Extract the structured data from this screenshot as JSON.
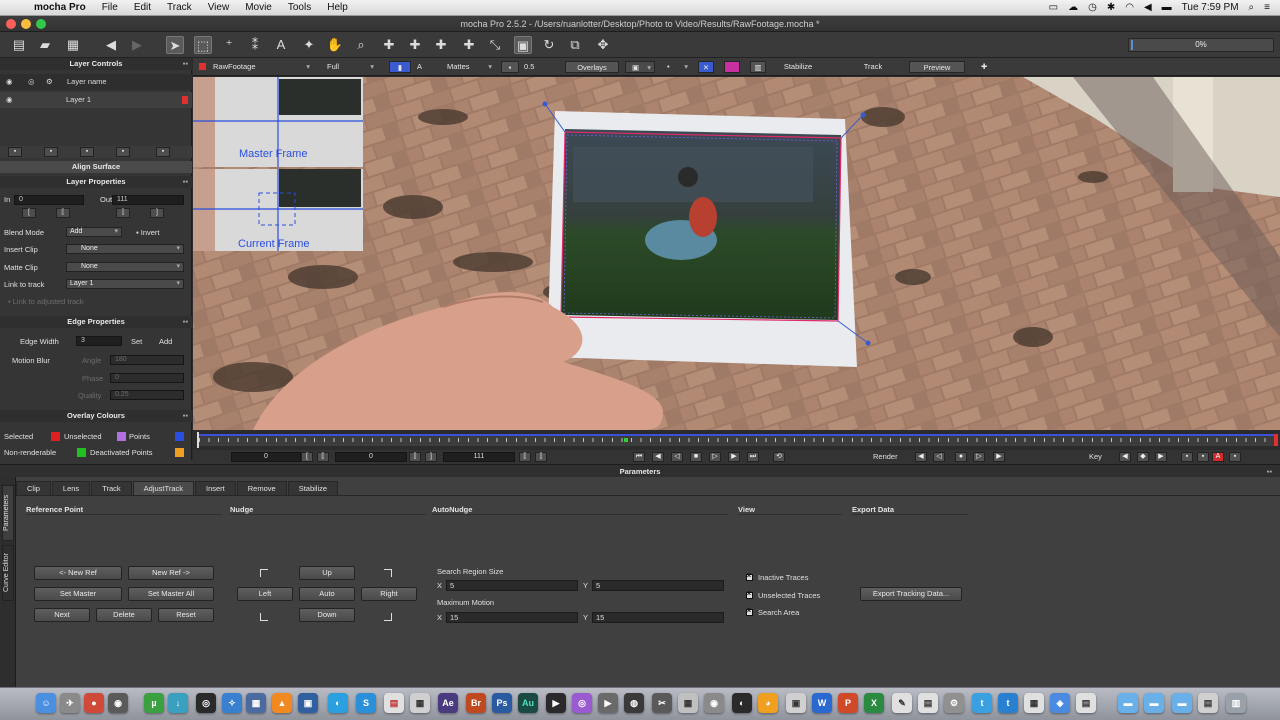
{
  "menubar": {
    "app": "mocha Pro",
    "items": [
      "File",
      "Edit",
      "Track",
      "View",
      "Movie",
      "Tools",
      "Help"
    ],
    "clock": "Tue 7:59 PM"
  },
  "window": {
    "title": "mocha Pro 2.5.2 - /Users/ruanlotter/Desktop/Photo to Video/Results/RawFootage.mocha *"
  },
  "toolbar": {
    "progress": "0%"
  },
  "layer_controls": {
    "title": "Layer Controls",
    "col_name": "Layer name",
    "layers": [
      {
        "name": "Layer 1",
        "color": "#e03030"
      }
    ],
    "align_surface": "Align Surface"
  },
  "layer_properties": {
    "title": "Layer Properties",
    "in_label": "In",
    "in_value": "0",
    "out_label": "Out",
    "out_value": "111",
    "blend_mode_label": "Blend Mode",
    "blend_mode_value": "Add",
    "invert_label": "Invert",
    "insert_clip_label": "Insert Clip",
    "insert_clip_value": "None",
    "matte_clip_label": "Matte Clip",
    "matte_clip_value": "None",
    "link_track_label": "Link to track",
    "link_track_value": "Layer 1",
    "link_adjusted_label": "Link to adjusted track"
  },
  "edge_properties": {
    "title": "Edge Properties",
    "edge_width_label": "Edge Width",
    "edge_width_value": "3",
    "set_label": "Set",
    "add_label": "Add",
    "motion_blur_label": "Motion Blur",
    "angle_label": "Angle",
    "angle_value": "180",
    "phase_label": "Phase",
    "phase_value": "0",
    "quality_label": "Quality",
    "quality_value": "0.25"
  },
  "overlay_colours": {
    "title": "Overlay Colours",
    "selected": "Selected",
    "unselected": "Unselected",
    "points": "Points",
    "non_renderable": "Non-renderable",
    "deactivated_points": "Deactivated Points",
    "colors": {
      "selected": "#e02020",
      "unselected": "#e02020",
      "points": "#b070e0",
      "points2": "#2a4ee0",
      "non_renderable": "#20c020",
      "deactivated": "#f0a020"
    }
  },
  "viewer_bar": {
    "clip": "RawFootage",
    "resolution": "Full",
    "mattes": "Mattes",
    "opacity": "0.5",
    "overlays": "Overlays",
    "stabilize": "Stabilize",
    "track": "Track",
    "preview": "Preview"
  },
  "viewer": {
    "master_frame": "Master Frame",
    "current_frame": "Current Frame"
  },
  "transport": {
    "in": "0",
    "current": "0",
    "out": "111",
    "render": "Render",
    "key": "Key"
  },
  "parameters": {
    "title": "Parameters",
    "side_tabs": [
      "Parameters",
      "Curve Editor"
    ],
    "tabs": [
      "Clip",
      "Lens",
      "Track",
      "AdjustTrack",
      "Insert",
      "Remove",
      "Stabilize"
    ],
    "active_tab": "AdjustTrack",
    "groups": {
      "reference_point": "Reference Point",
      "nudge": "Nudge",
      "autonudge": "AutoNudge",
      "view": "View",
      "export_data": "Export Data"
    },
    "buttons": {
      "prev_ref": "<- New Ref",
      "next_ref": "New Ref ->",
      "set_master": "Set Master",
      "set_master_all": "Set Master All",
      "next": "Next",
      "delete": "Delete",
      "reset": "Reset",
      "up": "Up",
      "left": "Left",
      "auto": "Auto",
      "right": "Right",
      "down": "Down",
      "export_tracking": "Export Tracking Data..."
    },
    "search_region_label": "Search Region Size",
    "search_x_label": "X",
    "search_x": "5",
    "search_y_label": "Y",
    "search_y": "5",
    "max_motion_label": "Maximum Motion",
    "motion_x_label": "X",
    "motion_x": "15",
    "motion_y_label": "Y",
    "motion_y": "15",
    "view_options": [
      "Inactive Traces",
      "Unselected Traces",
      "Search Area"
    ]
  }
}
